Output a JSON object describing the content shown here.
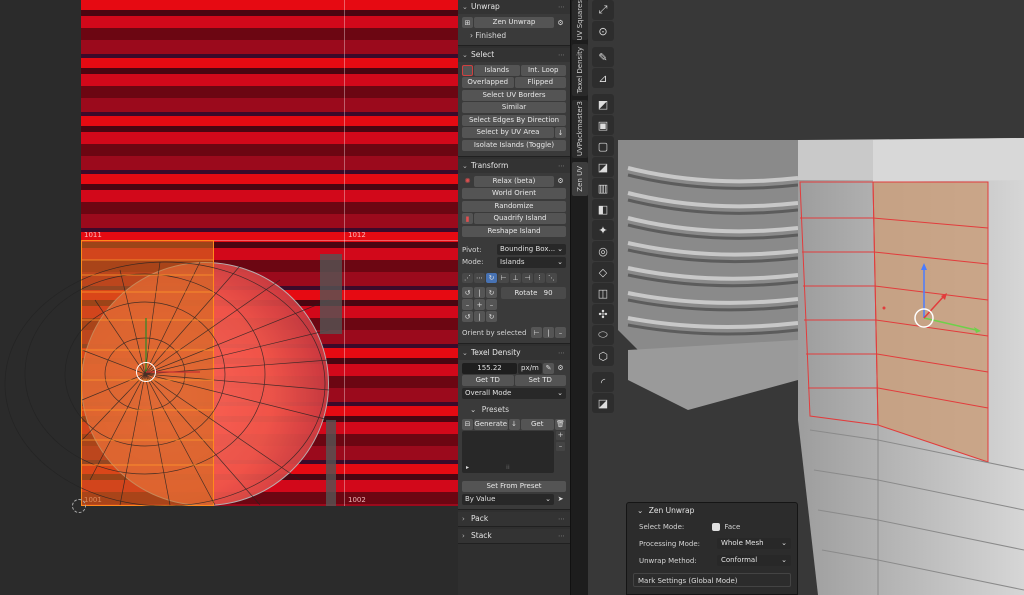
{
  "uv_editor": {
    "tiles": [
      "1011",
      "1012",
      "1001",
      "1002"
    ]
  },
  "unwrap": {
    "header": "Unwrap",
    "zen_unwrap_btn": "Zen Unwrap",
    "finished": "Finished"
  },
  "select": {
    "header": "Select",
    "islands": "Islands",
    "int_loop": "Int. Loop",
    "overlapped": "Overlapped",
    "flipped": "Flipped",
    "select_uv_borders": "Select UV Borders",
    "similar": "Similar",
    "select_edges_by_direction": "Select Edges By Direction",
    "select_by_uv_area": "Select by UV Area",
    "isolate_islands": "Isolate Islands (Toggle)"
  },
  "transform": {
    "header": "Transform",
    "relax": "Relax (beta)",
    "world_orient": "World Orient",
    "randomize": "Randomize",
    "quadrify": "Quadrify Island",
    "reshape": "Reshape Island",
    "pivot_label": "Pivot:",
    "pivot_value": "Bounding Box...",
    "mode_label": "Mode:",
    "mode_value": "Islands",
    "rotate_label": "Rotate",
    "rotate_value": "90",
    "orient_label": "Orient by selected"
  },
  "texel_density": {
    "header": "Texel Density",
    "value": "155.22",
    "unit": "px/m",
    "get_td": "Get TD",
    "set_td": "Set TD",
    "mode": "Overall Mode",
    "presets_header": "Presets",
    "generate": "Generate",
    "get": "Get",
    "set_from_preset": "Set From Preset",
    "by_value": "By Value"
  },
  "pack": {
    "header": "Pack"
  },
  "stack": {
    "header": "Stack"
  },
  "side_tabs": [
    "UV Squares",
    "Texel Density",
    "UVPackmaster3",
    "Zen UV"
  ],
  "zen_popup": {
    "title": "Zen Unwrap",
    "select_mode_label": "Select Mode:",
    "select_mode_value": "Face",
    "processing_mode_label": "Processing Mode:",
    "processing_mode_value": "Whole Mesh",
    "unwrap_method_label": "Unwrap Method:",
    "unwrap_method_value": "Conformal",
    "mark_settings": "Mark Settings (Global Mode)"
  },
  "colors": {
    "accent_blue": "#4772b3",
    "selection_orange": "#ff8a1c",
    "texture_red": "#e60a12",
    "edge_red": "#e23c3c"
  }
}
